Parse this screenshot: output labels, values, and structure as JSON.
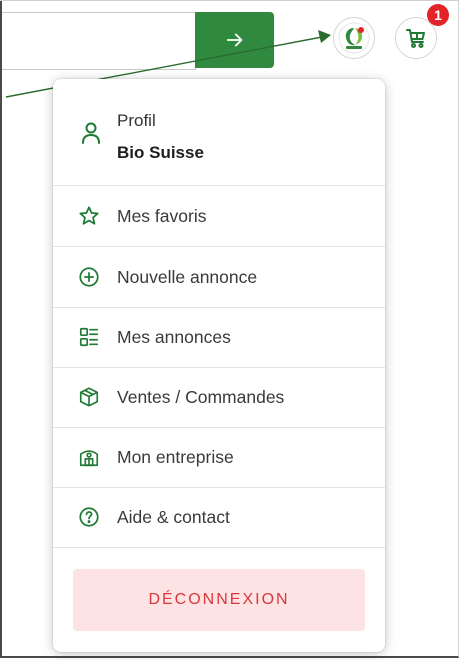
{
  "header": {
    "submit_icon": "arrow-right-icon",
    "profile_avatar": "bio-suisse-logo",
    "cart_icon": "shopping-cart-icon",
    "cart_count": "1"
  },
  "colors": {
    "brand_green": "#2f8a3f",
    "icon_green": "#1f7a34",
    "badge_red": "#e2242a",
    "logout_bg": "#fde3e3",
    "logout_text": "#d8393c"
  },
  "menu": {
    "profile": {
      "label": "Profil",
      "name": "Bio Suisse",
      "icon": "user-icon"
    },
    "items": [
      {
        "label": "Mes favoris",
        "icon": "star-icon"
      },
      {
        "label": "Nouvelle annonce",
        "icon": "plus-circle-icon"
      },
      {
        "label": "Mes annonces",
        "icon": "list-icon"
      },
      {
        "label": "Ventes / Commandes",
        "icon": "package-icon"
      },
      {
        "label": "Mon entreprise",
        "icon": "building-icon"
      },
      {
        "label": "Aide & contact",
        "icon": "help-circle-icon"
      }
    ],
    "logout_label": "DÉCONNEXION"
  }
}
